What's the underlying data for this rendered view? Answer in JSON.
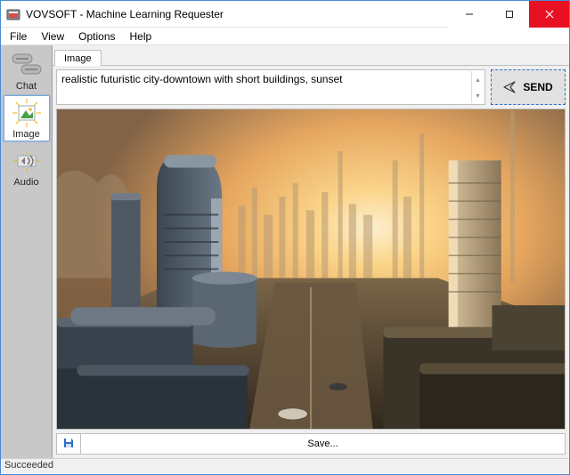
{
  "window": {
    "title": "VOVSOFT - Machine Learning Requester"
  },
  "menubar": {
    "items": [
      "File",
      "View",
      "Options",
      "Help"
    ]
  },
  "sidebar": {
    "items": [
      {
        "label": "Chat",
        "icon": "chat-icon",
        "selected": false
      },
      {
        "label": "Image",
        "icon": "image-icon",
        "selected": true
      },
      {
        "label": "Audio",
        "icon": "audio-icon",
        "selected": false
      }
    ]
  },
  "main": {
    "active_tab": "Image",
    "prompt_value": "realistic futuristic city-downtown with short buildings, sunset",
    "send_label": "SEND",
    "save_label": "Save..."
  },
  "statusbar": {
    "text": "Succeeded"
  }
}
